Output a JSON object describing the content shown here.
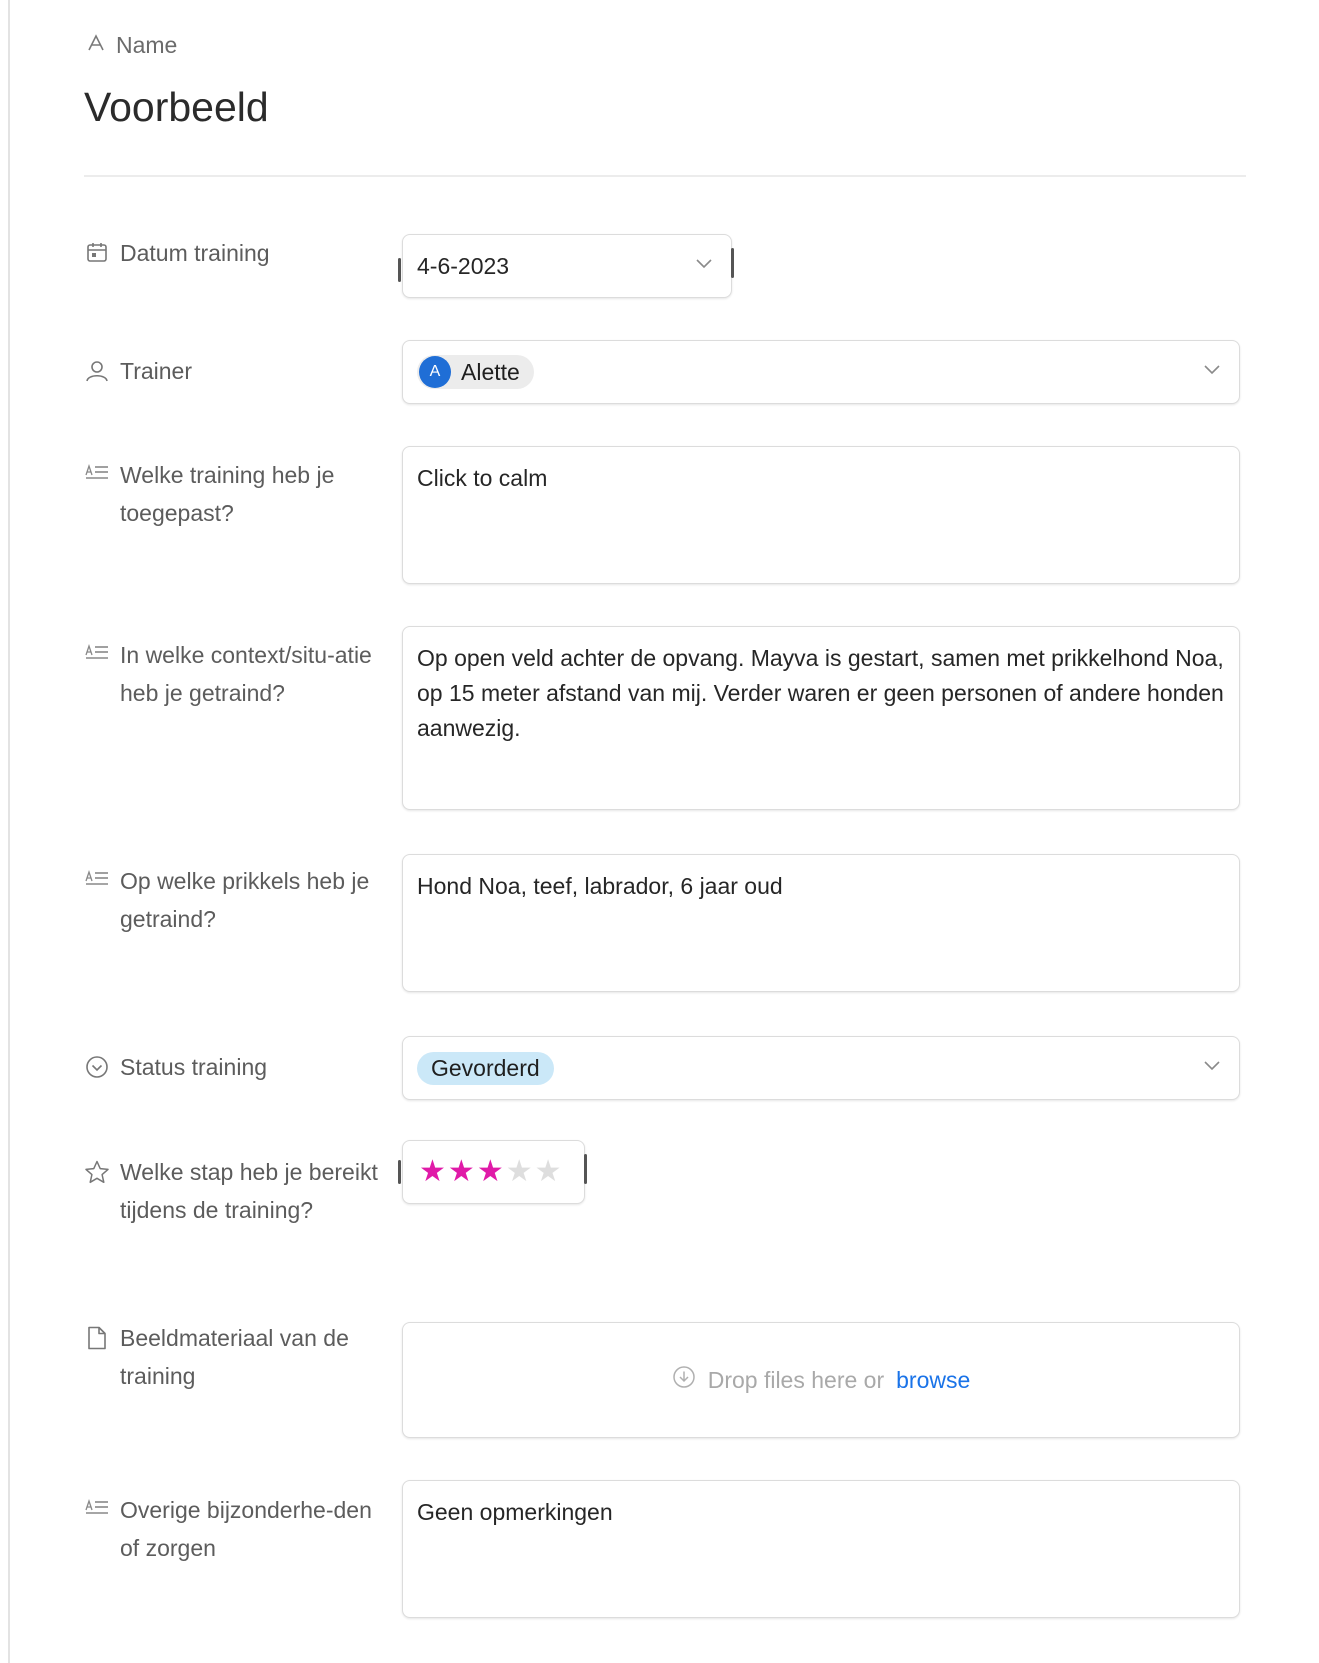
{
  "header": {
    "name_label": "Name",
    "title": "Voorbeeld"
  },
  "fields": {
    "date": {
      "label": "Datum training",
      "value": "4-6-2023",
      "icon": "calendar-icon"
    },
    "trainer": {
      "label": "Trainer",
      "value": "Alette",
      "avatar_initial": "A",
      "avatar_color": "#1f6ed6",
      "icon": "person-icon"
    },
    "training_applied": {
      "label": "Welke training heb je toegepast?",
      "value": "Click to calm",
      "icon": "long-text-icon"
    },
    "context": {
      "label": "In welke context/situ-atie heb je getraind?",
      "value": "Op open veld achter de opvang. Mayva is gestart, samen met prikkelhond Noa, op 15 meter afstand van mij. Verder waren er geen personen of andere honden aanwezig.",
      "icon": "long-text-icon"
    },
    "stimuli": {
      "label": "Op welke prikkels heb je getraind?",
      "value": "Hond Noa, teef, labrador, 6 jaar oud",
      "icon": "long-text-icon"
    },
    "status": {
      "label": "Status training",
      "value": "Gevorderd",
      "pill_color": "#cbe8f8",
      "icon": "status-circle-icon"
    },
    "rating": {
      "label": "Welke stap heb je bereikt tijdens de training?",
      "value": 3,
      "max": 5,
      "star_color": "#e01aa8",
      "icon": "star-outline-icon"
    },
    "media": {
      "label": "Beeldmateriaal van de training",
      "drop_text": "Drop files here or",
      "browse_text": "browse",
      "icon": "file-icon"
    },
    "other": {
      "label": "Overige bijzonderhe-den of zorgen",
      "value": "Geen opmerkingen",
      "icon": "long-text-icon"
    }
  }
}
